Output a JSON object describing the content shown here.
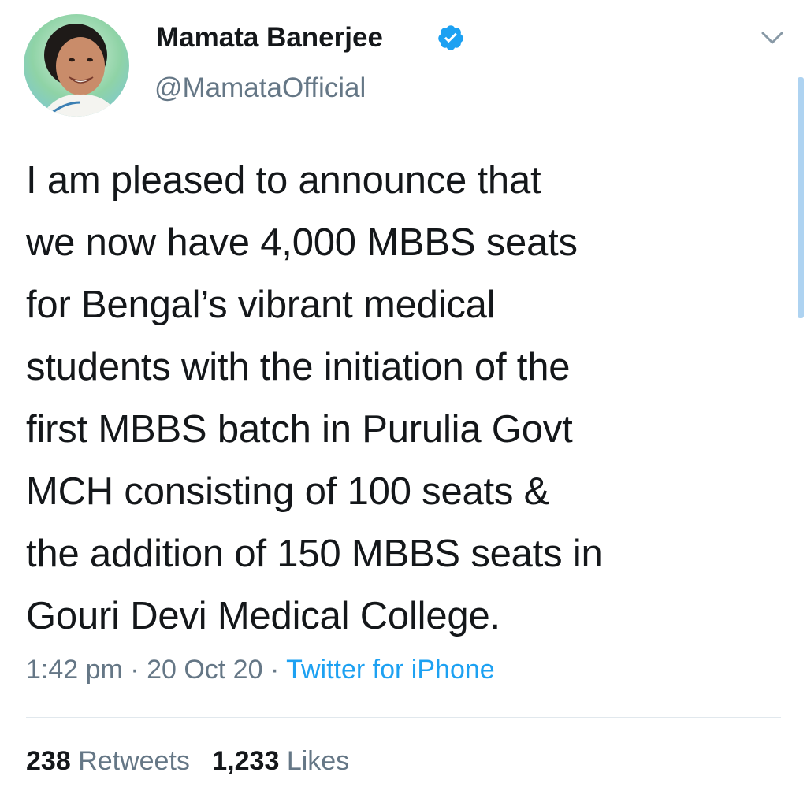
{
  "author": {
    "display_name": "Mamata Banerjee",
    "handle": "@MamataOfficial",
    "verified": true
  },
  "tweet": {
    "text": "I am pleased to announce that\nwe now have 4,000 MBBS seats\nfor Bengal’s vibrant medical\nstudents with the initiation of the\nfirst MBBS batch in Purulia Govt\nMCH consisting of 100 seats &\nthe addition of 150 MBBS seats in\nGouri Devi Medical College.",
    "time": "1:42 pm",
    "date": "20 Oct 20",
    "separator": " · ",
    "source": "Twitter for iPhone"
  },
  "stats": {
    "retweets_count": "238",
    "retweets_label": "Retweets",
    "likes_count": "1,233",
    "likes_label": "Likes"
  },
  "colors": {
    "accent": "#1da1f2",
    "muted": "#657786",
    "text": "#14171a",
    "divider": "#e1e8ed"
  },
  "icons": {
    "verified": "verified-badge-icon",
    "menu": "chevron-down-icon"
  }
}
